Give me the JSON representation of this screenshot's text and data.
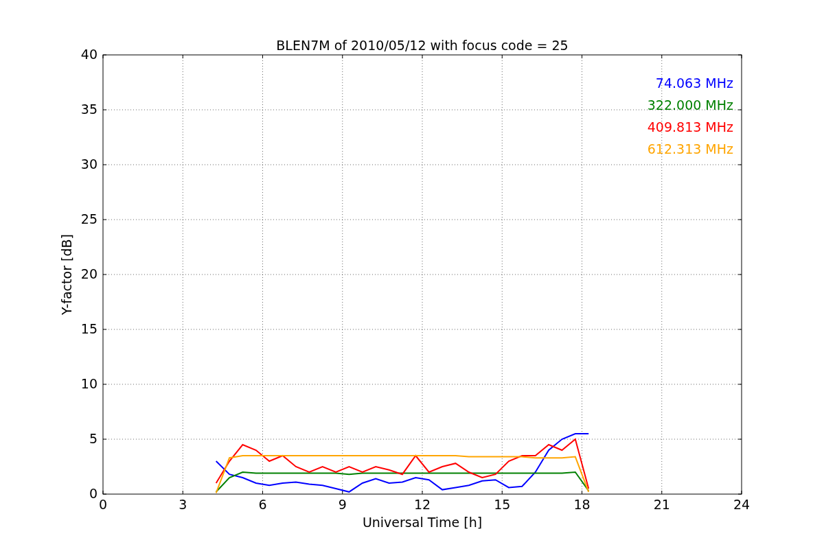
{
  "figure": {
    "chart_data": {
      "type": "line",
      "title": "BLEN7M of 2010/05/12 with focus code = 25",
      "xlabel": "Universal Time [h]",
      "ylabel": "Y-factor [dB]",
      "x": [
        4.25,
        4.75,
        5.25,
        5.75,
        6.25,
        6.75,
        7.25,
        7.75,
        8.25,
        8.75,
        9.25,
        9.75,
        10.25,
        10.75,
        11.25,
        11.75,
        12.25,
        12.75,
        13.25,
        13.75,
        14.25,
        14.75,
        15.25,
        15.75,
        16.25,
        16.75,
        17.25,
        17.75,
        18.25
      ],
      "series": [
        {
          "name": "74.063 MHz",
          "color": "#0000ff",
          "values": [
            3.0,
            1.8,
            1.5,
            1.0,
            0.8,
            1.0,
            1.1,
            0.9,
            0.8,
            0.5,
            0.2,
            1.0,
            1.4,
            1.0,
            1.1,
            1.5,
            1.3,
            0.4,
            0.6,
            0.8,
            1.2,
            1.3,
            0.6,
            0.7,
            2.0,
            4.0,
            5.0,
            5.5,
            5.5
          ]
        },
        {
          "name": "322.000 MHz",
          "color": "#008000",
          "values": [
            0.2,
            1.5,
            2.0,
            1.9,
            1.9,
            1.9,
            1.9,
            1.9,
            1.9,
            1.9,
            1.8,
            1.9,
            1.9,
            1.9,
            1.9,
            1.9,
            1.9,
            1.9,
            1.9,
            1.9,
            1.9,
            1.9,
            1.9,
            1.9,
            1.9,
            1.9,
            1.9,
            2.0,
            0.3
          ]
        },
        {
          "name": "409.813 MHz",
          "color": "#ff0000",
          "values": [
            1.0,
            3.0,
            4.5,
            4.0,
            3.0,
            3.5,
            2.5,
            2.0,
            2.5,
            2.0,
            2.5,
            2.0,
            2.5,
            2.2,
            1.8,
            3.5,
            2.0,
            2.5,
            2.8,
            2.0,
            1.5,
            1.8,
            3.0,
            3.5,
            3.5,
            4.5,
            4.0,
            5.0,
            0.5
          ]
        },
        {
          "name": "612.313 MHz",
          "color": "#ffa500",
          "values": [
            0.1,
            3.3,
            3.5,
            3.5,
            3.5,
            3.5,
            3.5,
            3.5,
            3.5,
            3.5,
            3.5,
            3.5,
            3.5,
            3.5,
            3.5,
            3.5,
            3.5,
            3.5,
            3.5,
            3.4,
            3.4,
            3.4,
            3.4,
            3.4,
            3.3,
            3.3,
            3.3,
            3.4,
            0.2
          ]
        }
      ],
      "xlim": [
        0,
        24
      ],
      "ylim": [
        0,
        40
      ],
      "xticks": [
        0,
        3,
        6,
        9,
        12,
        15,
        18,
        21,
        24
      ],
      "yticks": [
        0,
        5,
        10,
        15,
        20,
        25,
        30,
        35,
        40
      ],
      "grid": true
    }
  }
}
